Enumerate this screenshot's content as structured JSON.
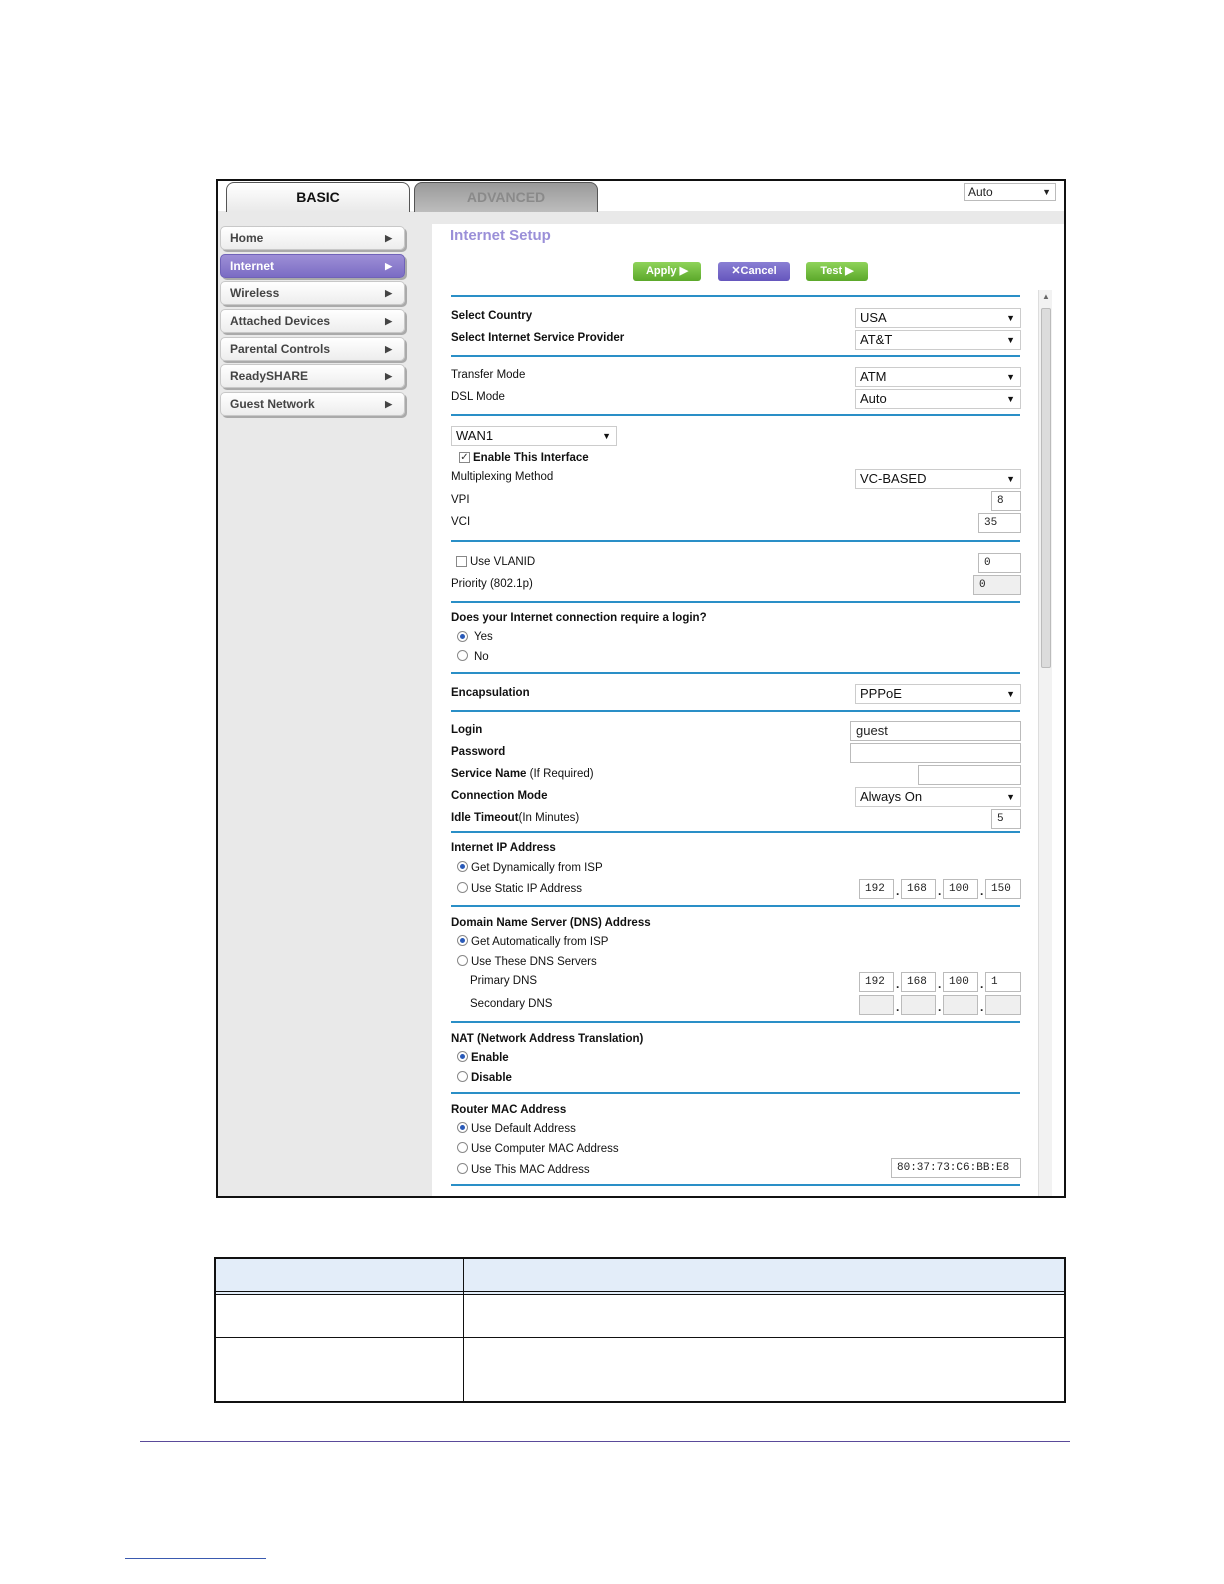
{
  "tabs": {
    "basic": "BASIC",
    "advanced": "ADVANCED"
  },
  "language": "Auto",
  "sidebar": {
    "items": [
      {
        "label": "Home"
      },
      {
        "label": "Internet"
      },
      {
        "label": "Wireless"
      },
      {
        "label": "Attached Devices"
      },
      {
        "label": "Parental Controls"
      },
      {
        "label": "ReadySHARE"
      },
      {
        "label": "Guest Network"
      }
    ],
    "active": "Internet"
  },
  "page": {
    "title": "Internet Setup"
  },
  "buttons": {
    "apply": "Apply ▶",
    "cancel": "✕Cancel",
    "test": "Test ▶"
  },
  "form": {
    "country": {
      "label": "Select Country",
      "value": "USA"
    },
    "isp": {
      "label": "Select Internet Service Provider",
      "value": "AT&T"
    },
    "transfer_mode": {
      "label": "Transfer Mode",
      "value": "ATM"
    },
    "dsl_mode": {
      "label": "DSL Mode",
      "value": "Auto"
    },
    "wan": {
      "value": "WAN1"
    },
    "enable_interface": {
      "label": "Enable This Interface",
      "checked": true
    },
    "multiplexing": {
      "label": "Multiplexing Method",
      "value": "VC-BASED"
    },
    "vpi": {
      "label": "VPI",
      "value": "8"
    },
    "vci": {
      "label": "VCI",
      "value": "35"
    },
    "vlan": {
      "label": "Use VLANID",
      "value": "0",
      "checked": false
    },
    "priority": {
      "label": "Priority   (802.1p)",
      "value": "0"
    },
    "login_required": {
      "label": "Does your Internet connection require a login?",
      "yes": "Yes",
      "no": "No",
      "selected": "Yes"
    },
    "encapsulation": {
      "label": "Encapsulation",
      "value": "PPPoE"
    },
    "login": {
      "label": "Login",
      "value": "guest"
    },
    "password": {
      "label": "Password",
      "value": ""
    },
    "service_name": {
      "label": "Service Name",
      "label_suffix": " (If Required)",
      "value": ""
    },
    "connection_mode": {
      "label": "Connection Mode",
      "value": "Always On"
    },
    "idle_timeout": {
      "label": "Idle Timeout",
      "label_suffix": "(In Minutes)",
      "value": "5"
    },
    "internet_ip": {
      "label": "Internet IP Address",
      "dynamic": "Get Dynamically from ISP",
      "static": "Use Static IP Address",
      "selected": "dynamic",
      "octets": [
        "192",
        "168",
        "100",
        "150"
      ]
    },
    "dns": {
      "label": "Domain Name Server (DNS) Address",
      "auto": "Get Automatically from ISP",
      "manual": "Use These DNS Servers",
      "selected": "auto",
      "primary_label": "Primary DNS",
      "primary": [
        "192",
        "168",
        "100",
        "1"
      ],
      "secondary_label": "Secondary DNS",
      "secondary": [
        "",
        "",
        "",
        ""
      ]
    },
    "nat": {
      "label": "NAT (Network Address Translation)",
      "enable": "Enable",
      "disable": "Disable",
      "selected": "Enable"
    },
    "mac": {
      "label": "Router MAC Address",
      "default": "Use Default Address",
      "computer": "Use Computer MAC Address",
      "custom": "Use This MAC Address",
      "selected": "default",
      "value": "80:37:73:C6:BB:E8"
    }
  }
}
